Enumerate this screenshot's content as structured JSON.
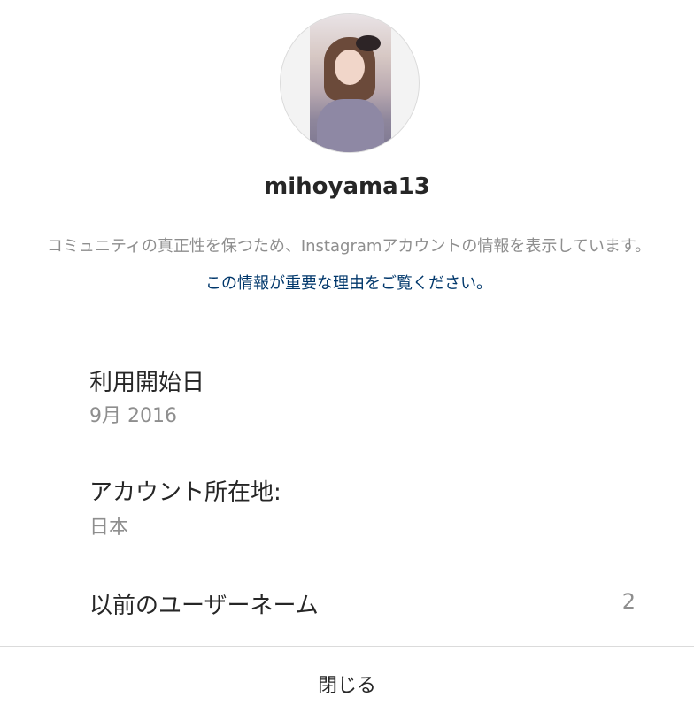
{
  "profile": {
    "username": "mihoyama13",
    "description_text": "コミュニティの真正性を保つため、Instagramアカウントの情報を表示しています。",
    "description_link": "この情報が重要な理由をご覧ください。"
  },
  "info": {
    "start_date_label": "利用開始日",
    "start_date_value": "9月 2016",
    "location_label": "アカウント所在地:",
    "location_value": "日本",
    "prev_usernames_label": "以前のユーザーネーム",
    "prev_usernames_count": "2"
  },
  "actions": {
    "close_label": "閉じる"
  }
}
